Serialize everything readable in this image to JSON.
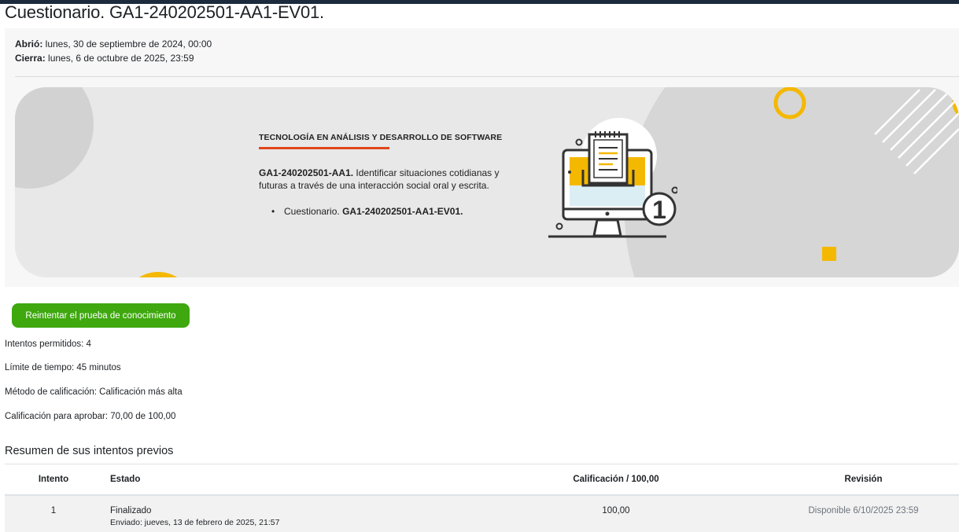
{
  "page": {
    "title": "Cuestionario. GA1-240202501-AA1-EV01."
  },
  "dates": {
    "opened_label": "Abrió:",
    "opened_value": "lunes, 30 de septiembre de 2024, 00:00",
    "closes_label": "Cierra:",
    "closes_value": "lunes, 6 de octubre de 2025, 23:59"
  },
  "banner": {
    "heading": "TECNOLOGÍA EN ANÁLISIS Y DESARROLLO DE SOFTWARE",
    "activity_code": "GA1-240202501-AA1.",
    "activity_desc": "Identificar situaciones cotidianas y futuras a través de una interacción social oral y escrita.",
    "list_item_prefix": "Cuestionario.",
    "list_item_code": "GA1-240202501-AA1-EV01.",
    "badge_number": "1",
    "colors": {
      "accent_red": "#e0471b",
      "accent_yellow": "#f5b800",
      "background": "#e8e8e8"
    },
    "illustration_icon": "computer-quiz-icon"
  },
  "actions": {
    "retry_label": "Reintentar el prueba de conocimiento",
    "retry_color": "#3ea80e"
  },
  "info": {
    "attempts": "Intentos permitidos: 4",
    "time_limit": "Límite de tiempo: 45 minutos",
    "grading_method": "Método de calificación: Calificación más alta",
    "pass_grade": "Calificación para aprobar: 70,00 de 100,00"
  },
  "summary": {
    "title": "Resumen de sus intentos previos",
    "headers": {
      "attempt": "Intento",
      "state": "Estado",
      "grade": "Calificación / 100,00",
      "review": "Revisión"
    },
    "rows": [
      {
        "attempt": "1",
        "state": "Finalizado",
        "submitted": "Enviado: jueves, 13 de febrero de 2025, 21:57",
        "grade": "100,00",
        "review": "Disponible 6/10/2025 23:59"
      }
    ]
  }
}
